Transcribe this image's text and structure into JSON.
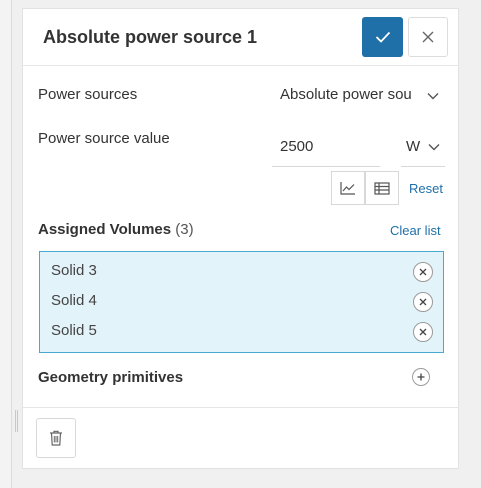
{
  "panel": {
    "title": "Absolute power source 1"
  },
  "power_sources": {
    "label": "Power sources",
    "selected": "Absolute power sou"
  },
  "power_source_value": {
    "label": "Power source value",
    "value": "2500",
    "unit": "W",
    "reset_label": "Reset"
  },
  "assigned_volumes": {
    "title": "Assigned Volumes",
    "count": "(3)",
    "clear_label": "Clear list",
    "items": [
      {
        "label": "Solid 3"
      },
      {
        "label": "Solid 4"
      },
      {
        "label": "Solid 5"
      }
    ]
  },
  "geometry_primitives": {
    "title": "Geometry primitives"
  },
  "colors": {
    "accent": "#1f6fa8",
    "selection_bg": "#e3f3fa",
    "selection_border": "#49a8cf"
  },
  "icons": {
    "confirm": "check-icon",
    "close": "close-icon",
    "chart": "line-chart-icon",
    "table": "table-icon",
    "remove": "remove-circle-icon",
    "add": "plus-circle-icon",
    "delete": "trash-icon"
  }
}
